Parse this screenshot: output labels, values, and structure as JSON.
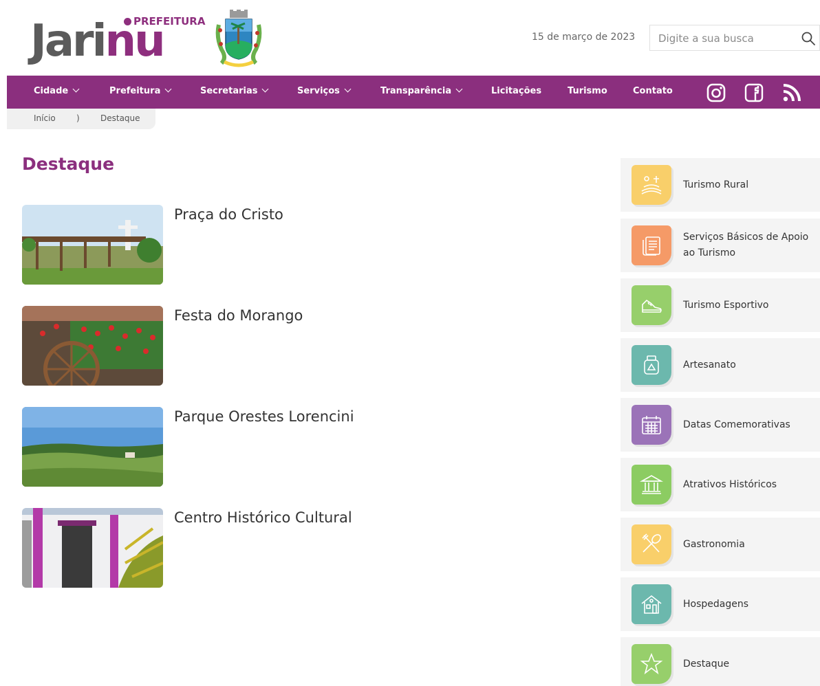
{
  "header": {
    "logo_prefix": "PREFEITURA",
    "logo_word_a": "Jari",
    "logo_word_b": "nu",
    "date": "15 de março de 2023",
    "search_placeholder": "Digite a sua busca"
  },
  "nav": {
    "items": [
      {
        "label": "Cidade",
        "dropdown": true
      },
      {
        "label": "Prefeitura",
        "dropdown": true
      },
      {
        "label": "Secretarias",
        "dropdown": true
      },
      {
        "label": "Serviços",
        "dropdown": true
      },
      {
        "label": "Transparência",
        "dropdown": true
      },
      {
        "label": "Licitações",
        "dropdown": false
      },
      {
        "label": "Turismo",
        "dropdown": false
      },
      {
        "label": "Contato",
        "dropdown": false
      }
    ],
    "social": [
      "instagram-icon",
      "facebook-icon",
      "rss-icon"
    ]
  },
  "breadcrumb": {
    "home": "Início",
    "separator": ")",
    "current": "Destaque"
  },
  "main": {
    "title": "Destaque",
    "articles": [
      {
        "title": "Praça do Cristo"
      },
      {
        "title": "Festa do Morango"
      },
      {
        "title": "Parque Orestes Lorencini"
      },
      {
        "title": "Centro Histórico Cultural"
      }
    ]
  },
  "sidebar": {
    "items": [
      {
        "label": "Turismo Rural",
        "color": "#f9cf6a",
        "icon": "farm-icon"
      },
      {
        "label": "Serviços Básicos de Apoio ao Turismo",
        "color": "#f59a67",
        "icon": "document-icon"
      },
      {
        "label": "Turismo Esportivo",
        "color": "#97cf6b",
        "icon": "sneaker-icon"
      },
      {
        "label": "Artesanato",
        "color": "#6cb8ad",
        "icon": "craft-jar-icon"
      },
      {
        "label": "Datas Comemorativas",
        "color": "#9b73b8",
        "icon": "calendar-icon"
      },
      {
        "label": "Atrativos Históricos",
        "color": "#8ccc62",
        "icon": "museum-icon"
      },
      {
        "label": "Gastronomia",
        "color": "#f9cf6a",
        "icon": "cutlery-icon"
      },
      {
        "label": "Hospedagens",
        "color": "#6cb8ad",
        "icon": "house-icon"
      },
      {
        "label": "Destaque",
        "color": "#97cf6b",
        "icon": "star-icon"
      }
    ]
  },
  "colors": {
    "brand": "#8b2f7e",
    "logo_gray": "#5b5b5b"
  }
}
